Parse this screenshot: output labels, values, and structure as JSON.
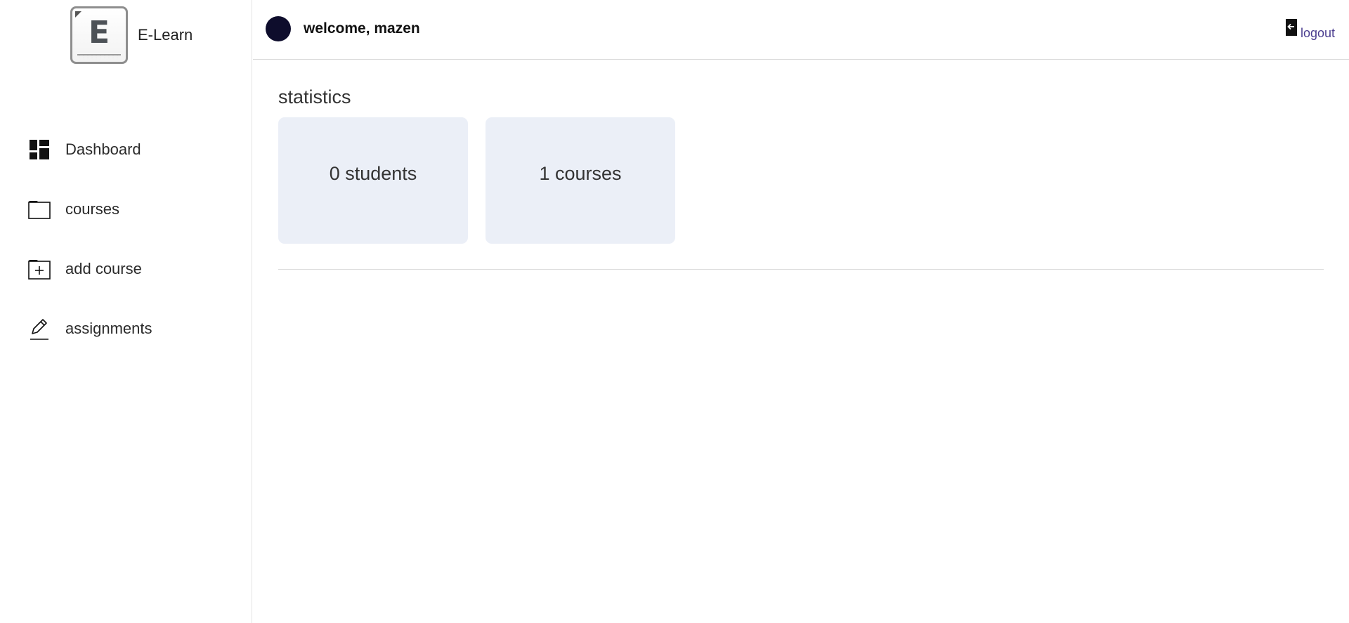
{
  "brand": {
    "name": "E-Learn",
    "logo_letter": "E",
    "logo_icon": "elearn-logo-icon"
  },
  "sidebar": {
    "items": [
      {
        "label": "Dashboard",
        "icon": "dashboard-grid-icon"
      },
      {
        "label": "courses",
        "icon": "folder-icon"
      },
      {
        "label": "add course",
        "icon": "folder-plus-icon"
      },
      {
        "label": "assignments",
        "icon": "pencil-icon"
      }
    ]
  },
  "header": {
    "welcome": "welcome, mazen",
    "logout_label": "logout",
    "logout_icon": "logout-door-icon",
    "avatar_color": "#0e0d2c"
  },
  "main": {
    "section_title": "statistics",
    "stats": [
      {
        "text": "0 students"
      },
      {
        "text": "1 courses"
      }
    ],
    "card_color": "#ebeff7"
  },
  "colors": {
    "logout_link": "#4a3d8f",
    "divider": "#dcdcdc"
  }
}
